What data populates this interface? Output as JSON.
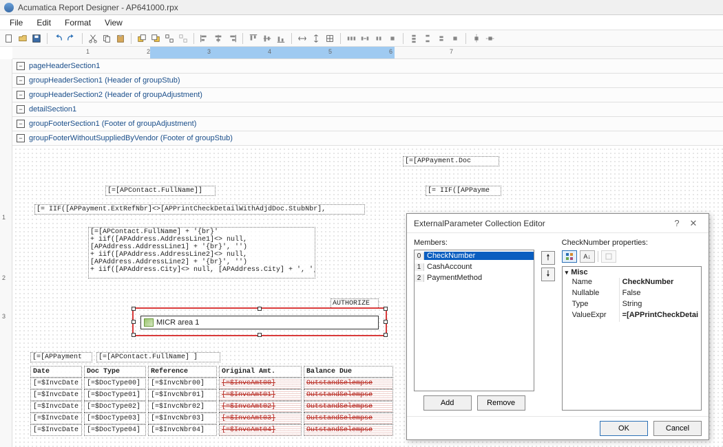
{
  "window": {
    "title": "Acumatica Report Designer - AP641000.rpx"
  },
  "menu": {
    "file": "File",
    "edit": "Edit",
    "format": "Format",
    "view": "View"
  },
  "sections": [
    {
      "label": "pageHeaderSection1"
    },
    {
      "label": "groupHeaderSection1 (Header of groupStub)"
    },
    {
      "label": "groupHeaderSection2 (Header of groupAdjustment)"
    },
    {
      "label": "detailSection1"
    },
    {
      "label": "groupFooterSection1 (Footer of groupAdjustment)"
    },
    {
      "label": "groupFooterWithoutSuppliedByVendor (Footer of groupStub)"
    }
  ],
  "canvas": {
    "appaymentDoc": "[=[APPayment.Doc",
    "apcontactFull": "[=[APContact.FullName]]",
    "iifAppayme": "[= IIF([APPayme",
    "iifLong": "[= IIF([APPayment.ExtRefNbr]<>[APPrintCheckDetailWithAdjdDoc.StubNbr],",
    "addressBlock": "[=[APContact.FullName] + '{br}'\n+ iif([APAddress.AddressLine1]<> null,\n[APAddress.AddressLine1] + '{br}', '')\n+ iif([APAddress.AddressLine2]<> null,\n[APAddress.AddressLine2] + '{br}', '')\n+ iif([APAddress.City]<> null, [APAddress.City] + ', ',",
    "authorize": "AUTHORIZE",
    "micr": "MICR area 1",
    "appaymentShort": "[=[APPayment",
    "apcontactFull2": "[=[APContact.FullName] ]"
  },
  "grid": {
    "headers": [
      "Date",
      "Doc Type",
      "Reference",
      "Original Amt.",
      "Balance Due"
    ],
    "rows": [
      [
        "[=$InvcDate",
        "[=$DocType00]",
        "[=$InvcNbr00]",
        "[=$InvcAmt00]",
        "OutstandSelempse"
      ],
      [
        "[=$InvcDate",
        "[=$DocType01]",
        "[=$InvcNbr01]",
        "[=$InvcAmt01]",
        "OutstandSelempse"
      ],
      [
        "[=$InvcDate",
        "[=$DocType02]",
        "[=$InvcNbr02]",
        "[=$InvcAmt02]",
        "OutstandSelempse"
      ],
      [
        "[=$InvcDate",
        "[=$DocType03]",
        "[=$InvcNbr03]",
        "[=$InvcAmt03]",
        "OutstandSelempse"
      ],
      [
        "[=$InvcDate",
        "[=$DocType04]",
        "[=$InvcNbr04]",
        "[=$InvcAmt04]",
        "OutstandSelempse"
      ]
    ]
  },
  "dialog": {
    "title": "ExternalParameter Collection Editor",
    "membersLabel": "Members:",
    "propsLabel": "CheckNumber properties:",
    "members": [
      {
        "i": "0",
        "name": "CheckNumber"
      },
      {
        "i": "1",
        "name": "CashAccount"
      },
      {
        "i": "2",
        "name": "PaymentMethod"
      }
    ],
    "cat": "Misc",
    "props": [
      {
        "k": "Name",
        "v": "CheckNumber",
        "bold": true
      },
      {
        "k": "Nullable",
        "v": "False",
        "bold": false
      },
      {
        "k": "Type",
        "v": "String",
        "bold": false
      },
      {
        "k": "ValueExpr",
        "v": "=[APPrintCheckDetai",
        "bold": true
      }
    ],
    "add": "Add",
    "remove": "Remove",
    "ok": "OK",
    "cancel": "Cancel"
  },
  "ruler": {
    "majors": [
      1,
      2,
      3,
      4,
      5,
      6,
      7
    ],
    "hl_start": 200,
    "hl_end": 555
  }
}
